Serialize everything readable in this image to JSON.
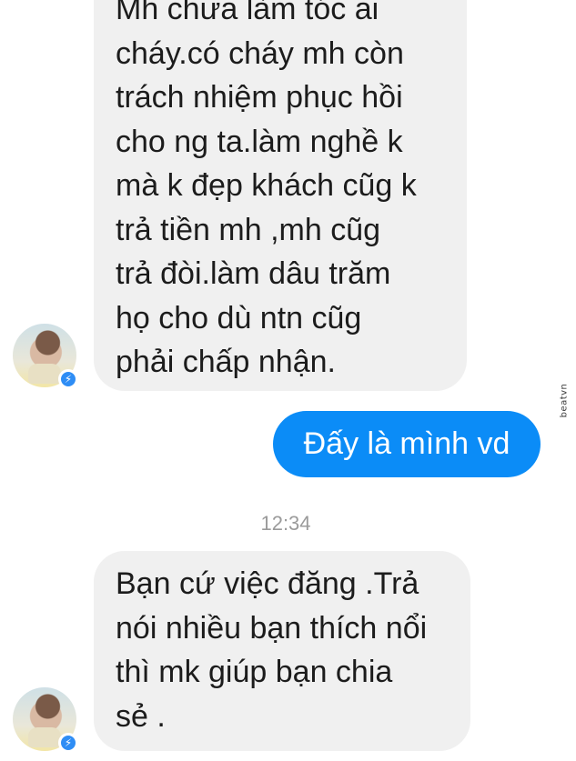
{
  "messages": [
    {
      "direction": "incoming",
      "lines": [
        "Mh chưa làm tóc ai",
        "cháy.có cháy mh còn",
        "trách nhiệm phục hồi",
        "cho ng ta.làm nghề k",
        "mà k đẹp khách cũg k",
        "trả tiền mh ,mh cũg",
        "trả đòi.làm dâu trăm",
        "họ cho dù ntn cũg",
        "phải chấp nhận."
      ]
    },
    {
      "direction": "outgoing",
      "text": "Đấy là mình vd"
    },
    {
      "direction": "incoming",
      "lines": [
        "Bạn cứ việc đăng .Trả",
        "nói nhiều bạn thích nổi",
        "thì mk giúp bạn chia",
        "sẻ ."
      ]
    }
  ],
  "timestamp": "12:34",
  "watermark": "beatvn",
  "colors": {
    "incoming_bubble": "#f0f0f0",
    "outgoing_bubble": "#0b8cf7",
    "timestamp_text": "#9b9b9b",
    "badge": "#2e8df5"
  },
  "icons": [
    "contact-avatar",
    "messenger-badge-icon"
  ]
}
